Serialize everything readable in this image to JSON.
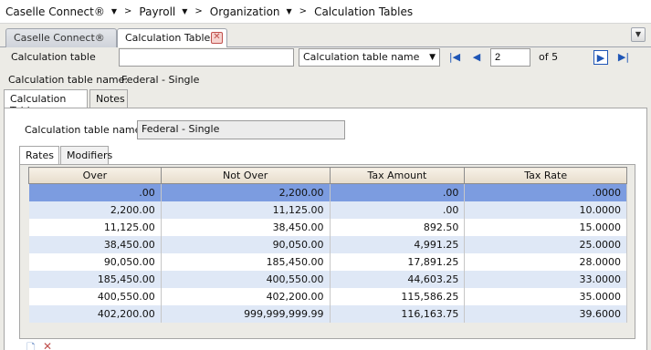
{
  "breadcrumbs": [
    {
      "label": "Caselle Connect®",
      "dropdown": true
    },
    {
      "label": "Payroll",
      "dropdown": true
    },
    {
      "label": "Organization",
      "dropdown": true
    },
    {
      "label": "Calculation Tables",
      "dropdown": false
    }
  ],
  "crumb_separator": ">",
  "tabs": [
    {
      "label": "Caselle Connect®",
      "active": false
    },
    {
      "label": "Calculation Tables",
      "active": true
    }
  ],
  "tab_close_glyph": "✕",
  "tab_menu_glyph": "▼",
  "toolbar": {
    "calc_table_label": "Calculation table",
    "calc_table_value": "",
    "sort_select_value": "Calculation table name",
    "page_value": "2",
    "page_of": "of 5"
  },
  "nav_glyphs": {
    "first": "|◀",
    "prev": "◀",
    "next": "▶",
    "last": "▶|"
  },
  "header_line": {
    "label": "Calculation table name:",
    "value": "Federal - Single"
  },
  "inner_tabs": [
    {
      "label": "Calculation Table",
      "active": true
    },
    {
      "label": "Notes",
      "active": false
    }
  ],
  "panel": {
    "name_label": "Calculation table name:",
    "name_value": "Federal - Single"
  },
  "rate_tabs": [
    {
      "label": "Rates",
      "active": true
    },
    {
      "label": "Modifiers",
      "active": false
    }
  ],
  "grid": {
    "columns": [
      "Over",
      "Not Over",
      "Tax Amount",
      "Tax Rate"
    ],
    "rows": [
      [
        ".00",
        "2,200.00",
        ".00",
        ".0000"
      ],
      [
        "2,200.00",
        "11,125.00",
        ".00",
        "10.0000"
      ],
      [
        "11,125.00",
        "38,450.00",
        "892.50",
        "15.0000"
      ],
      [
        "38,450.00",
        "90,050.00",
        "4,991.25",
        "25.0000"
      ],
      [
        "90,050.00",
        "185,450.00",
        "17,891.25",
        "28.0000"
      ],
      [
        "185,450.00",
        "400,550.00",
        "44,603.25",
        "33.0000"
      ],
      [
        "400,550.00",
        "402,200.00",
        "115,586.25",
        "35.0000"
      ],
      [
        "402,200.00",
        "999,999,999.99",
        "116,163.75",
        "39.6000"
      ]
    ],
    "selected_row": 0
  },
  "bottom_icons": {
    "new": "🗋",
    "delete": "✕"
  },
  "colors": {
    "selected_row": "#7c9ce0",
    "alt_row": "#dfe8f6",
    "nav_blue": "#1f56b6",
    "close_red": "#c0504d"
  }
}
